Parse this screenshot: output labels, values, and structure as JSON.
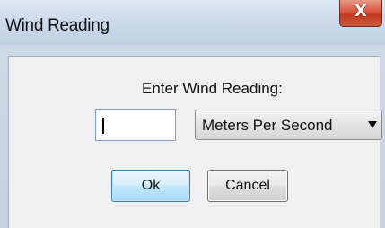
{
  "window": {
    "title": "Wind Reading",
    "close_glyph": "X"
  },
  "form": {
    "prompt": "Enter Wind Reading:",
    "input_value": "",
    "unit_selected": "Meters Per Second"
  },
  "buttons": {
    "ok_label": "Ok",
    "cancel_label": "Cancel"
  },
  "colors": {
    "close_button": "#d9573d",
    "ok_button_border": "#3c7fb1"
  }
}
